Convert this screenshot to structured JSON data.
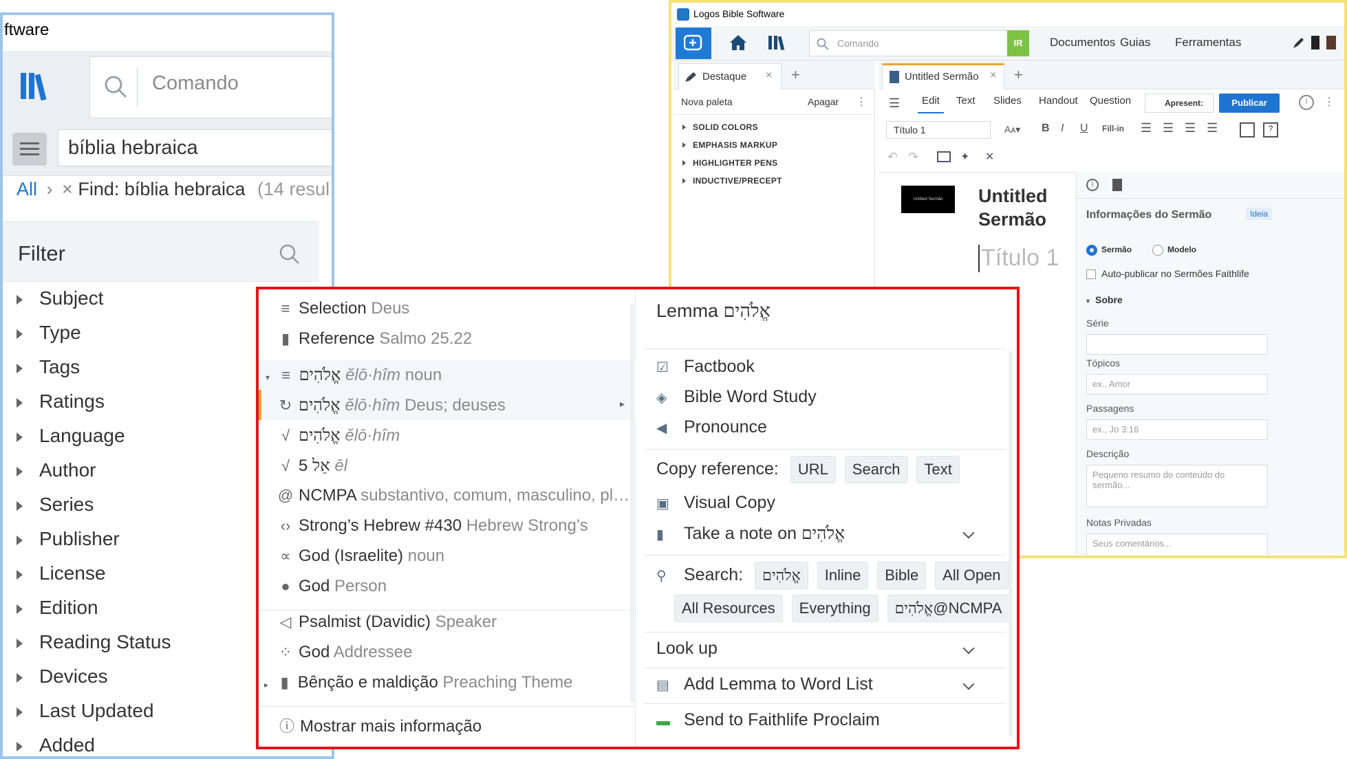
{
  "left_panel": {
    "title": "ftware",
    "command_placeholder": "Comando",
    "search_query": "bíblia hebraica",
    "breadcrumb": {
      "all": "All",
      "sep": "›",
      "close": "×",
      "find": "Find: bíblia hebraica",
      "results": "(14 resul"
    },
    "filter_title": "Filter",
    "facets": [
      "Subject",
      "Type",
      "Tags",
      "Ratings",
      "Language",
      "Author",
      "Series",
      "Publisher",
      "License",
      "Edition",
      "Reading Status",
      "Devices",
      "Last Updated",
      "Added"
    ]
  },
  "right_window": {
    "app_title": "Logos Bible Software",
    "command_placeholder": "Comando",
    "ir_label": "IR",
    "nav": [
      "Documentos",
      "Guias",
      "Ferramentas"
    ],
    "left_tab": "Destaque",
    "new_palette": "Nova paleta",
    "delete": "Apagar",
    "palettes": [
      "SOLID COLORS",
      "EMPHASIS MARKUP",
      "HIGHLIGHTER PENS",
      "INDUCTIVE/PRECEPT"
    ],
    "doc_tab": "Untitled Sermão",
    "editor_tabs": [
      "Edit",
      "Text",
      "Slides",
      "Handout",
      "Question"
    ],
    "present": "Apresent:",
    "publish": "Publicar",
    "style_select": "Título 1",
    "fill_in": "Fill-in",
    "thumb_text": "Untitled Sermão",
    "doc_title_line1": "Untitled",
    "doc_title_line2": "Sermão",
    "heading_placeholder": "Título 1",
    "info_title": "Informações do Sermão",
    "idea": "Ideia",
    "radio_sermon": "Sermão",
    "radio_model": "Modelo",
    "autopublish": "Auto-publicar no Sermões Faithlife",
    "about": "Sobre",
    "series_label": "Série",
    "topics_label": "Tópicos",
    "topics_ph": "ex., Amor",
    "passages_label": "Passagens",
    "passages_ph": "ex., Jo 3:16",
    "desc_label": "Descrição",
    "desc_ph": "Pequeno resumo do conteúdo do sermão...",
    "notes_label": "Notas Privadas",
    "notes_ph": "Seus comentários..."
  },
  "popup": {
    "left": {
      "selection_label": "Selection",
      "selection_value": "Deus",
      "reference_label": "Reference",
      "reference_value": "Salmo 25.22",
      "heb": "אֱלֹהִים",
      "row1_translit": "ĕlō·hîm",
      "row1_pos": "noun",
      "row2_translit": "ĕlō·hîm",
      "row2_gloss": "Deus; deuses",
      "row3_translit": "ĕlō·hîm",
      "row4_num": "5",
      "row4_heb": "אֵל",
      "row4_translit": "ēl",
      "ncmpa_label": "NCMPA",
      "ncmpa_value": "substantivo, comum, masculino, pl…",
      "strongs_label": "Strong’s Hebrew #430",
      "strongs_value": "Hebrew Strong’s",
      "sense_label": "God (Israelite)",
      "sense_value": "noun",
      "person_label": "God",
      "person_value": "Person",
      "speaker_label": "Psalmist (Davidic)",
      "speaker_value": "Speaker",
      "addressee_label": "God",
      "addressee_value": "Addressee",
      "theme_label": "Bênção e maldição",
      "theme_value": "Preaching Theme",
      "more_info": "Mostrar mais informação"
    },
    "right": {
      "lemma_label": "Lemma",
      "lemma_heb": "אֱלֹהִים",
      "factbook": "Factbook",
      "bws": "Bible Word Study",
      "pronounce": "Pronounce",
      "copy_ref": "Copy reference:",
      "copy_chips": [
        "URL",
        "Search",
        "Text"
      ],
      "visual_copy": "Visual Copy",
      "take_note": "Take a note on",
      "search_label": "Search:",
      "search_chips_row1": [
        "Inline",
        "Bible",
        "All Open"
      ],
      "search_chips_row2": [
        "All Resources",
        "Everything"
      ],
      "ncmpa_chip": "@NCMPA",
      "look_up": "Look up",
      "add_lemma": "Add Lemma to Word List",
      "send_proclaim": "Send to Faithlife Proclaim"
    }
  },
  "colors": {
    "accent_blue": "#1f74d2",
    "popup_border": "#e4141b",
    "left_border": "#9ec5e8",
    "right_border": "#f5e17a",
    "ir_green": "#7cc243",
    "proclaim_green": "#3aa845"
  }
}
